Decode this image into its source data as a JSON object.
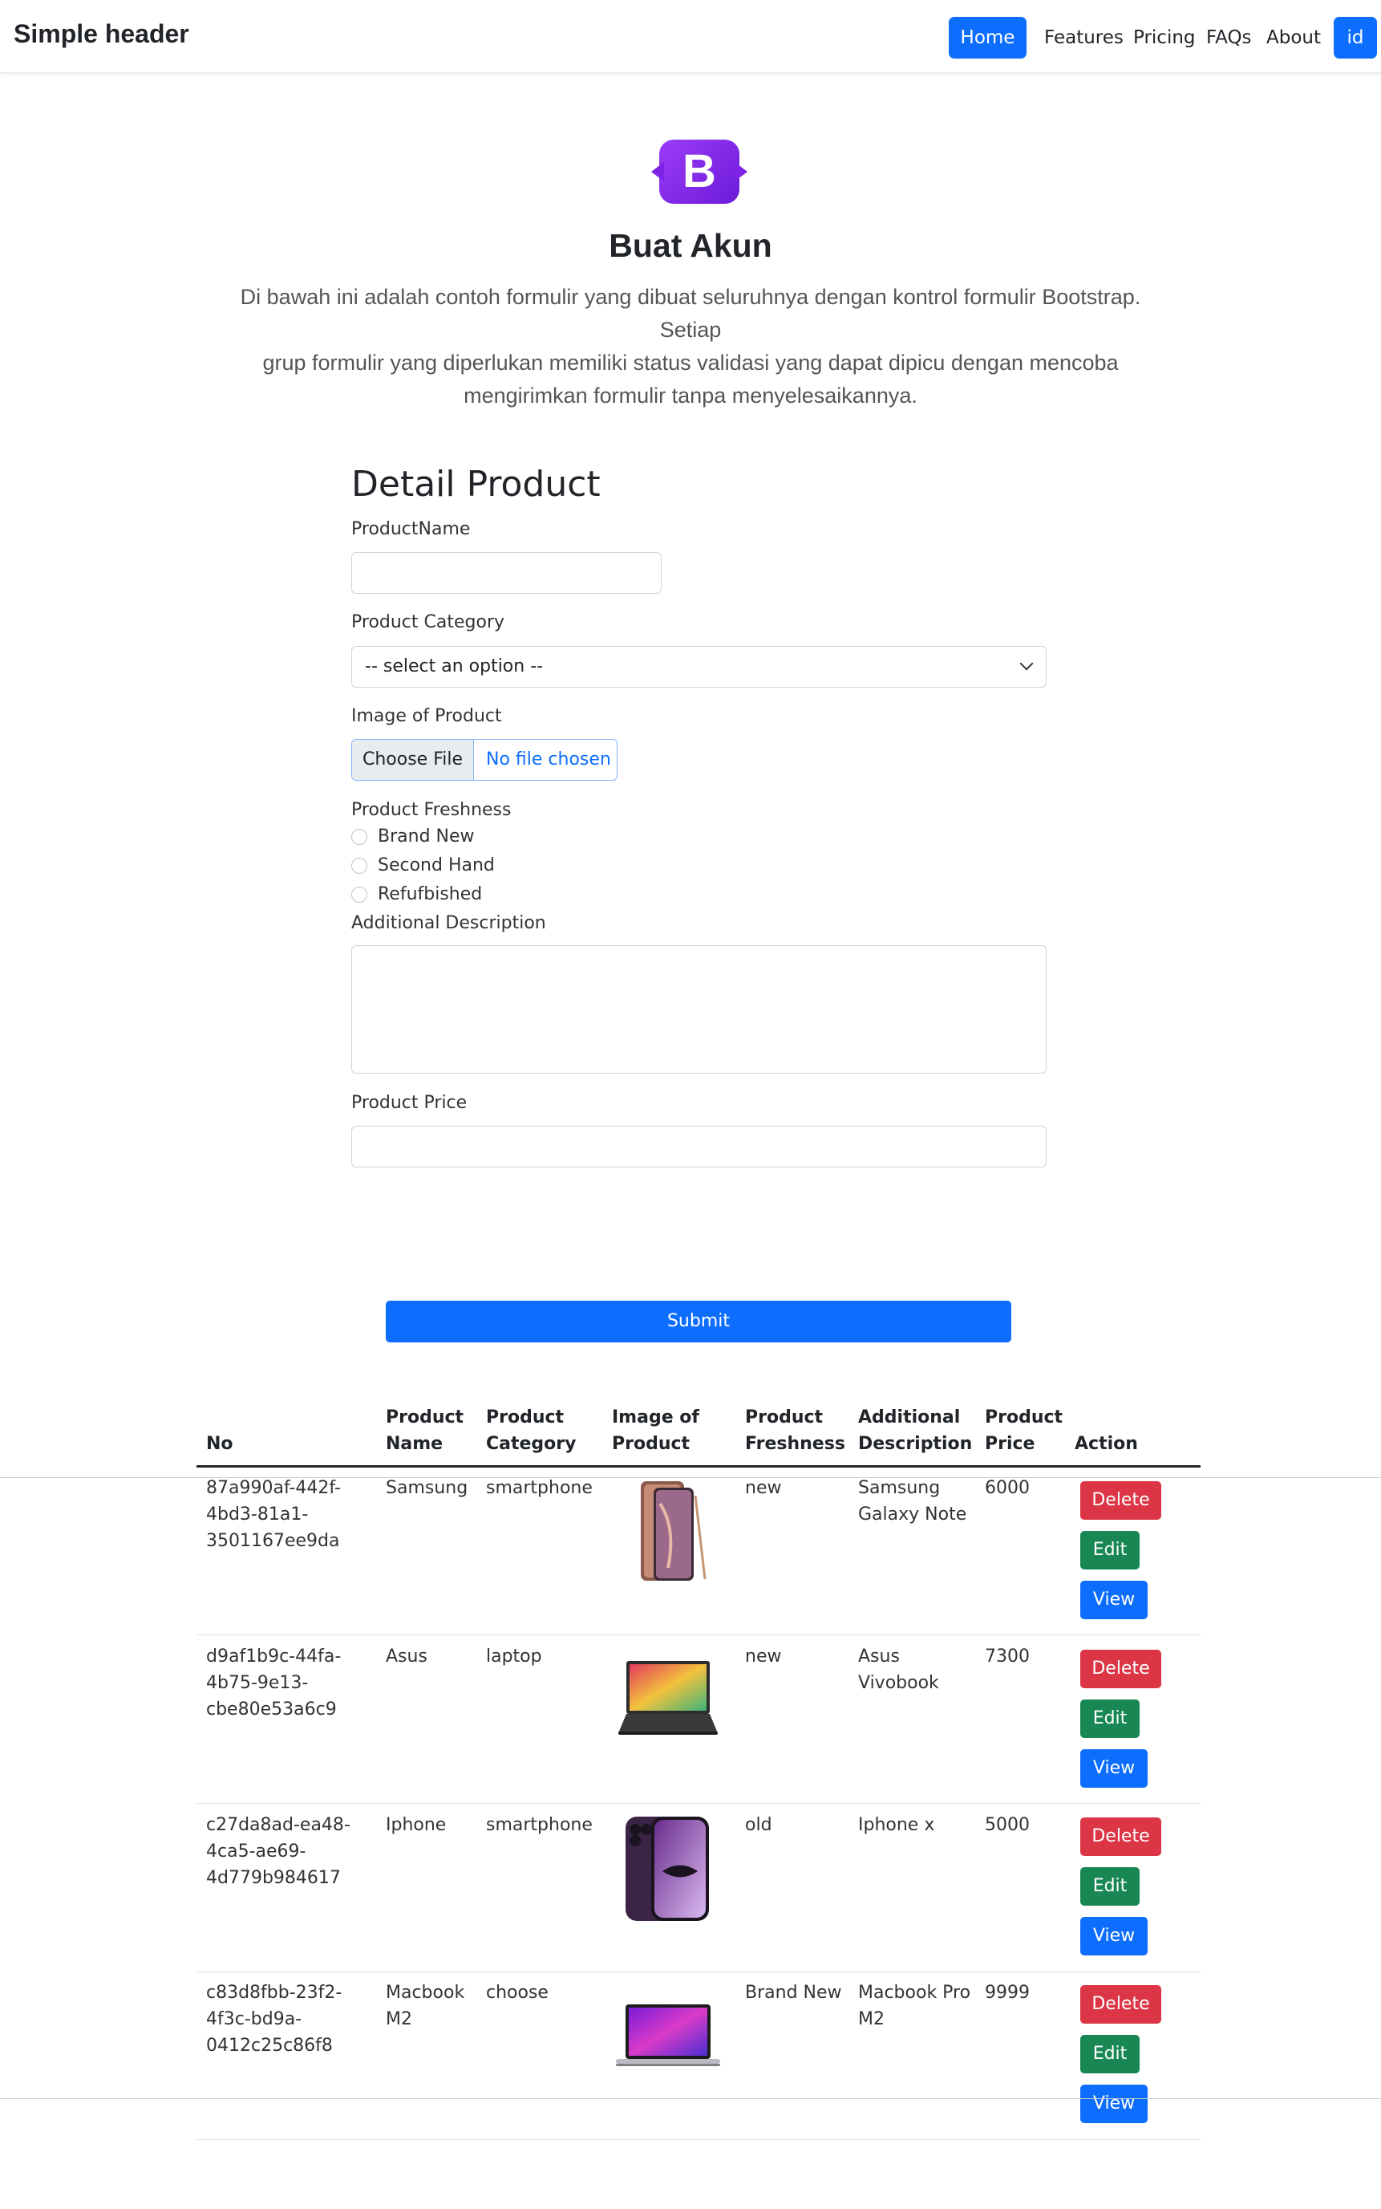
{
  "header": {
    "brand": "Simple header",
    "nav": [
      "Home",
      "Features",
      "Pricing",
      "FAQs",
      "About",
      "id"
    ],
    "accent": "#0d6efd"
  },
  "hero": {
    "logo_letter": "B",
    "title": "Buat Akun",
    "description_lines": [
      "Di bawah ini adalah contoh formulir yang dibuat seluruhnya dengan kontrol formulir Bootstrap. Setiap",
      "grup formulir yang diperlukan memiliki status validasi yang dapat dipicu dengan mencoba",
      "mengirimkan formulir tanpa menyelesaikannya."
    ]
  },
  "form": {
    "title": "Detail Product",
    "product_name_label": "ProductName",
    "product_name_value": "",
    "category_label": "Product Category",
    "category_selected": "-- select an option --",
    "image_label": "Image of Product",
    "file_button": "Choose File",
    "file_status": "No file chosen",
    "freshness_label": "Product Freshness",
    "freshness_options": [
      "Brand New",
      "Second Hand",
      "Refufbished"
    ],
    "description_label": "Additional Description",
    "description_value": "",
    "price_label": "Product Price",
    "price_value": "",
    "submit_label": "Submit"
  },
  "table": {
    "headers": [
      [
        "No"
      ],
      [
        "Product",
        "Name"
      ],
      [
        "Product",
        "Category"
      ],
      [
        "Image of",
        "Product"
      ],
      [
        "Product",
        "Freshness"
      ],
      [
        "Additional",
        "Description"
      ],
      [
        "Product",
        "Price"
      ],
      [
        "Action"
      ]
    ],
    "actions": [
      "Delete",
      "Edit",
      "View"
    ],
    "action_colors": {
      "delete": "#dc3545",
      "edit": "#198754",
      "view": "#0d6efd"
    },
    "rows": [
      {
        "id_lines": [
          "87a990af-442f-",
          "4bd3-81a1-",
          "3501167ee9da"
        ],
        "name_lines": [
          "Samsung"
        ],
        "category": "smartphone",
        "image": "samsung-galaxy-note-phone-icon",
        "freshness": "new",
        "description_lines": [
          "Samsung",
          "Galaxy Note"
        ],
        "price": "6000"
      },
      {
        "id_lines": [
          "d9af1b9c-44fa-",
          "4b75-9e13-",
          "cbe80e53a6c9"
        ],
        "name_lines": [
          "Asus"
        ],
        "category": "laptop",
        "image": "asus-vivobook-laptop-icon",
        "freshness": "new",
        "description_lines": [
          "Asus",
          "Vivobook"
        ],
        "price": "7300"
      },
      {
        "id_lines": [
          "c27da8ad-ea48-",
          "4ca5-ae69-",
          "4d779b984617"
        ],
        "name_lines": [
          "Iphone"
        ],
        "category": "smartphone",
        "image": "iphone-phone-icon",
        "freshness": "old",
        "description_lines": [
          "Iphone x"
        ],
        "price": "5000"
      },
      {
        "id_lines": [
          "c83d8fbb-23f2-",
          "4f3c-bd9a-",
          "0412c25c86f8"
        ],
        "name_lines": [
          "Macbook",
          "M2"
        ],
        "category": "choose",
        "image": "macbook-laptop-icon",
        "freshness": "Brand New",
        "description_lines": [
          "Macbook Pro",
          "M2"
        ],
        "price": "9999"
      }
    ]
  }
}
